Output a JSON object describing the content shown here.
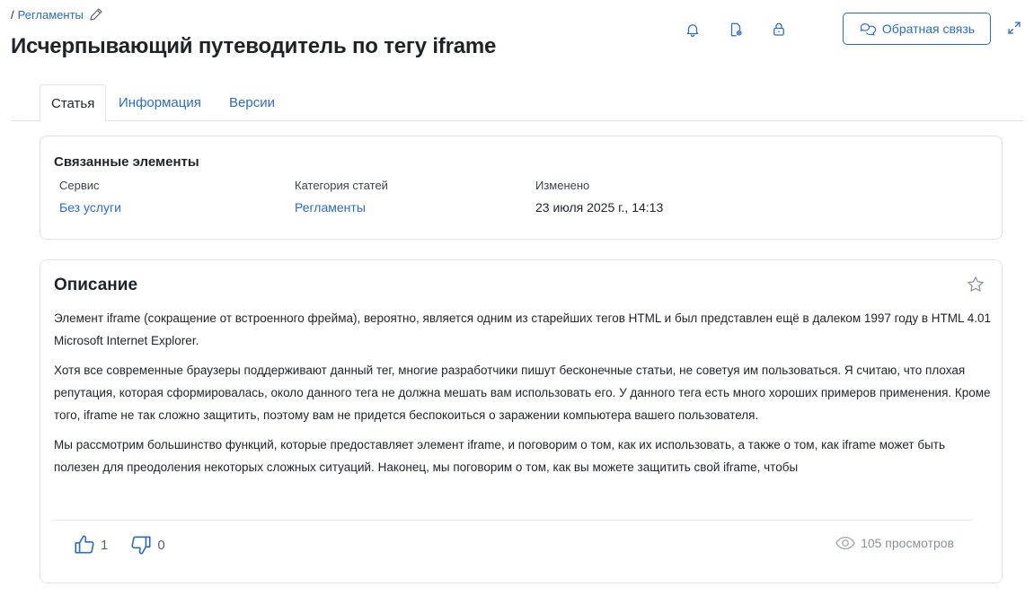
{
  "breadcrumb": {
    "separator": "/",
    "link": "Регламенты"
  },
  "page": {
    "title": "Исчерпывающий путеводитель по тегу iframe"
  },
  "header": {
    "icons": [
      "bell-icon",
      "document-settings-icon",
      "lock-icon"
    ],
    "feedback_label": "Обратная связь"
  },
  "tabs": [
    {
      "label": "Статья",
      "active": true
    },
    {
      "label": "Информация",
      "active": false
    },
    {
      "label": "Версии",
      "active": false
    }
  ],
  "related": {
    "title": "Связанные элементы",
    "service": {
      "label": "Сервис",
      "value": "Без услуги"
    },
    "category": {
      "label": "Категория статей",
      "value": "Регламенты"
    },
    "modified": {
      "label": "Изменено",
      "value": "23 июля 2025 г., 14:13"
    }
  },
  "description": {
    "title": "Описание",
    "paragraphs": [
      "Элемент iframe (сокращение от встроенного фрейма), вероятно, является одним из старейших тегов HTML и был представлен ещё в далеком 1997 году в HTML 4.01 Microsoft Internet Explorer.",
      "Хотя все современные браузеры поддерживают данный тег, многие разработчики пишут бесконечные статьи, не советуя им пользоваться. Я считаю, что плохая репутация, которая сформировалась, около данного тега не должна мешать вам использовать его. У данного тега есть много хороших примеров применения. Кроме того, iframe не так сложно защитить, поэтому вам не придется беспокоиться о заражении компьютера вашего пользователя.",
      "Мы рассмотрим большинство функций, которые предоставляет элемент iframe, и поговорим о том, как их использовать, а также о том, как iframe может быть полезен для преодоления некоторых сложных ситуаций. Наконец, мы поговорим о том, как вы можете защитить свой iframe, чтобы"
    ],
    "likes": "1",
    "dislikes": "0",
    "views": "105 просмотров"
  },
  "colors": {
    "accent": "#2b6cc4",
    "text": "#1f2329",
    "border": "#dfe3e8"
  }
}
